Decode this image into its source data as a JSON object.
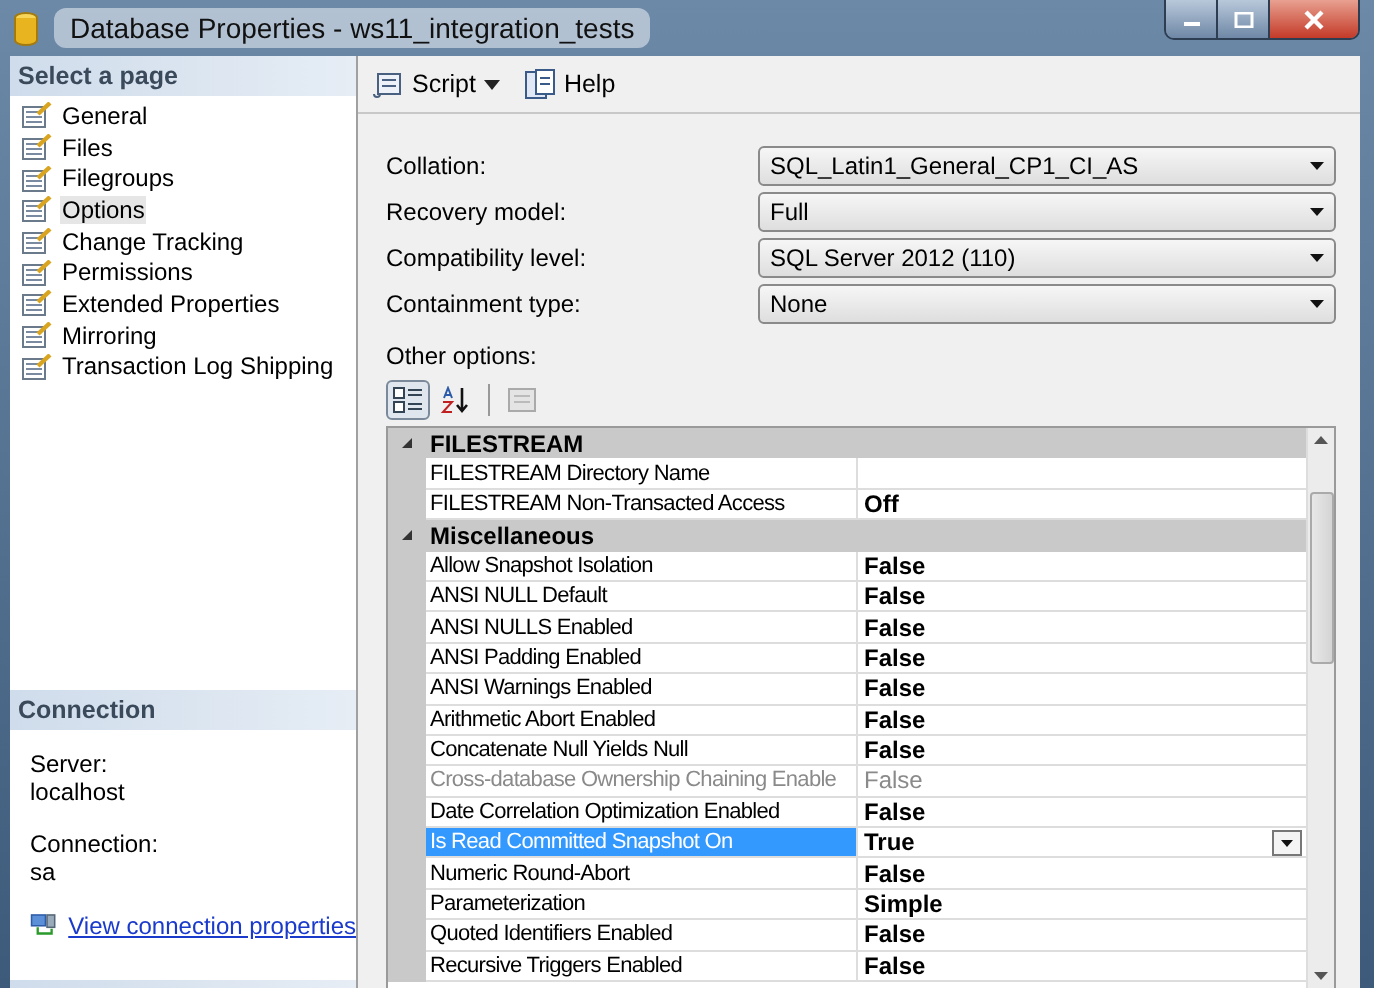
{
  "window": {
    "title": "Database Properties - ws11_integration_tests"
  },
  "sidebar": {
    "header": "Select a page",
    "items": [
      {
        "label": "General",
        "selected": false
      },
      {
        "label": "Files",
        "selected": false
      },
      {
        "label": "Filegroups",
        "selected": false
      },
      {
        "label": "Options",
        "selected": true
      },
      {
        "label": "Change Tracking",
        "selected": false
      },
      {
        "label": "Permissions",
        "selected": false
      },
      {
        "label": "Extended Properties",
        "selected": false
      },
      {
        "label": "Mirroring",
        "selected": false
      },
      {
        "label": "Transaction Log Shipping",
        "selected": false
      }
    ]
  },
  "connection": {
    "header": "Connection",
    "fields": [
      {
        "label": "Server:",
        "value": "localhost"
      },
      {
        "label": "Connection:",
        "value": "sa"
      }
    ],
    "link": "View connection properties"
  },
  "toolbar": {
    "script": "Script",
    "help": "Help"
  },
  "form": [
    {
      "label": "Collation:",
      "value": "SQL_Latin1_General_CP1_CI_AS"
    },
    {
      "label": "Recovery model:",
      "value": "Full"
    },
    {
      "label": "Compatibility level:",
      "value": "SQL Server 2012 (110)"
    },
    {
      "label": "Containment type:",
      "value": "None"
    }
  ],
  "other_options": {
    "label": "Other options:",
    "sort_buttons": [
      {
        "kind": "categorized",
        "selected": true
      },
      {
        "kind": "alphabetical",
        "selected": false
      }
    ],
    "groups": [
      {
        "name": "FILESTREAM",
        "expanded": true,
        "rows": [
          {
            "name": "FILESTREAM Directory Name",
            "selected": false,
            "disabled": false
          },
          {
            "name": "FILESTREAM Non-Transacted Access",
            "value": "Off",
            "selected": false,
            "disabled": false
          }
        ]
      },
      {
        "name": "Miscellaneous",
        "expanded": true,
        "rows": [
          {
            "name": "Allow Snapshot Isolation",
            "value": "False",
            "selected": false,
            "disabled": false
          },
          {
            "name": "ANSI NULL Default",
            "value": "False",
            "selected": false,
            "disabled": false
          },
          {
            "name": "ANSI NULLS Enabled",
            "value": "False",
            "selected": false,
            "disabled": false
          },
          {
            "name": "ANSI Padding Enabled",
            "value": "False",
            "selected": false,
            "disabled": false
          },
          {
            "name": "ANSI Warnings Enabled",
            "value": "False",
            "selected": false,
            "disabled": false
          },
          {
            "name": "Arithmetic Abort Enabled",
            "value": "False",
            "selected": false,
            "disabled": false
          },
          {
            "name": "Concatenate Null Yields Null",
            "value": "False",
            "selected": false,
            "disabled": false
          },
          {
            "name": "Cross-database Ownership Chaining Enable",
            "value": "False",
            "selected": false,
            "disabled": true
          },
          {
            "name": "Date Correlation Optimization Enabled",
            "value": "False",
            "selected": false,
            "disabled": false
          },
          {
            "name": "Is Read Committed Snapshot On",
            "value": "True",
            "selected": true,
            "disabled": false
          },
          {
            "name": "Numeric Round-Abort",
            "value": "False",
            "selected": false,
            "disabled": false
          },
          {
            "name": "Parameterization",
            "value": "Simple",
            "selected": false,
            "disabled": false
          },
          {
            "name": "Quoted Identifiers Enabled",
            "value": "False",
            "selected": false,
            "disabled": false
          },
          {
            "name": "Recursive Triggers Enabled",
            "value": "False",
            "selected": false,
            "disabled": false
          }
        ]
      }
    ]
  }
}
